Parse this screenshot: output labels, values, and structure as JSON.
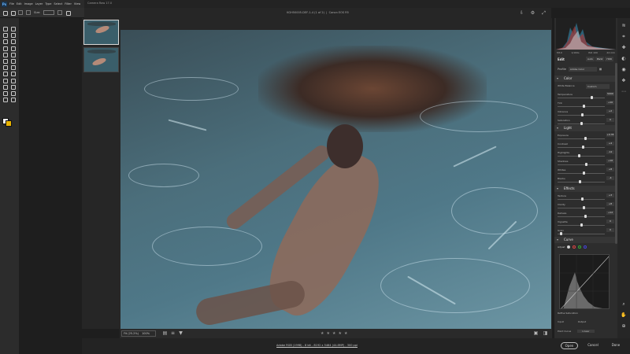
{
  "photoshop": {
    "logo": "Ps",
    "menu": [
      "File",
      "Edit",
      "Image",
      "Layer",
      "Type",
      "Select",
      "Filter",
      "View"
    ],
    "size_label": "Size:"
  },
  "dialog": {
    "app_title": "Camera Raw 17.0",
    "file_title": "KGH50005-DEF-1-4 (1 of 2)",
    "camera": "Canon EOS R5"
  },
  "canvas": {
    "zoom_mode": "Fit (25.2%)",
    "zoom_percent": "100%",
    "rating_stars": [
      "★",
      "★",
      "★",
      "★",
      "★"
    ]
  },
  "footer": {
    "info": "Adobe RGB (1998) - 8 bit - 8192 x 5464 (44.8MP) - 300 ppi",
    "open_label": "Open",
    "cancel_label": "Cancel",
    "done_label": "Done"
  },
  "panel": {
    "histogram_values": [
      "f/8.0",
      "1/160s",
      "ISO 100",
      "24 mm"
    ],
    "edit_title": "Edit",
    "edit_buttons": [
      "Auto",
      "B&W",
      "HDR"
    ],
    "profile_label": "Profile",
    "profile_value": "Adobe Color",
    "sections": {
      "color": "Color",
      "light": "Light",
      "effects": "Effects",
      "curve": "Curve"
    },
    "color_sliders": [
      {
        "label": "White Balance",
        "value": "Custom",
        "type": "select"
      },
      {
        "label": "Temperature",
        "value": "5000",
        "pos": 0.72
      },
      {
        "label": "Tint",
        "value": "+10",
        "pos": 0.55
      },
      {
        "label": "Vibrance",
        "value": "+2",
        "pos": 0.52
      },
      {
        "label": "Saturation",
        "value": "0",
        "pos": 0.5
      }
    ],
    "light_sliders": [
      {
        "label": "Exposure",
        "value": "+0.35",
        "pos": 0.58
      },
      {
        "label": "Contrast",
        "value": "+4",
        "pos": 0.53
      },
      {
        "label": "Highlights",
        "value": "-12",
        "pos": 0.44
      },
      {
        "label": "Shadows",
        "value": "+16",
        "pos": 0.6
      },
      {
        "label": "Whites",
        "value": "+8",
        "pos": 0.55
      },
      {
        "label": "Blacks",
        "value": "-4",
        "pos": 0.47
      }
    ],
    "effects_sliders": [
      {
        "label": "Texture",
        "value": "+3",
        "pos": 0.52
      },
      {
        "label": "Clarity",
        "value": "+8",
        "pos": 0.55
      },
      {
        "label": "Dehaze",
        "value": "+12",
        "pos": 0.58
      },
      {
        "label": "Vignette",
        "value": "0",
        "pos": 0.5
      },
      {
        "label": "Grain",
        "value": "0",
        "pos": 0.05
      }
    ],
    "curve_adjust_label": "Adjust",
    "curve_input_label": "Input",
    "curve_output_label": "Output",
    "point_curve_label": "Point Curve",
    "point_curve_value": "Linear",
    "refine_label": "Refine Saturation"
  },
  "colors": {
    "accent_fg": "#e8b300",
    "accent_bg": "#f2f2f2"
  }
}
